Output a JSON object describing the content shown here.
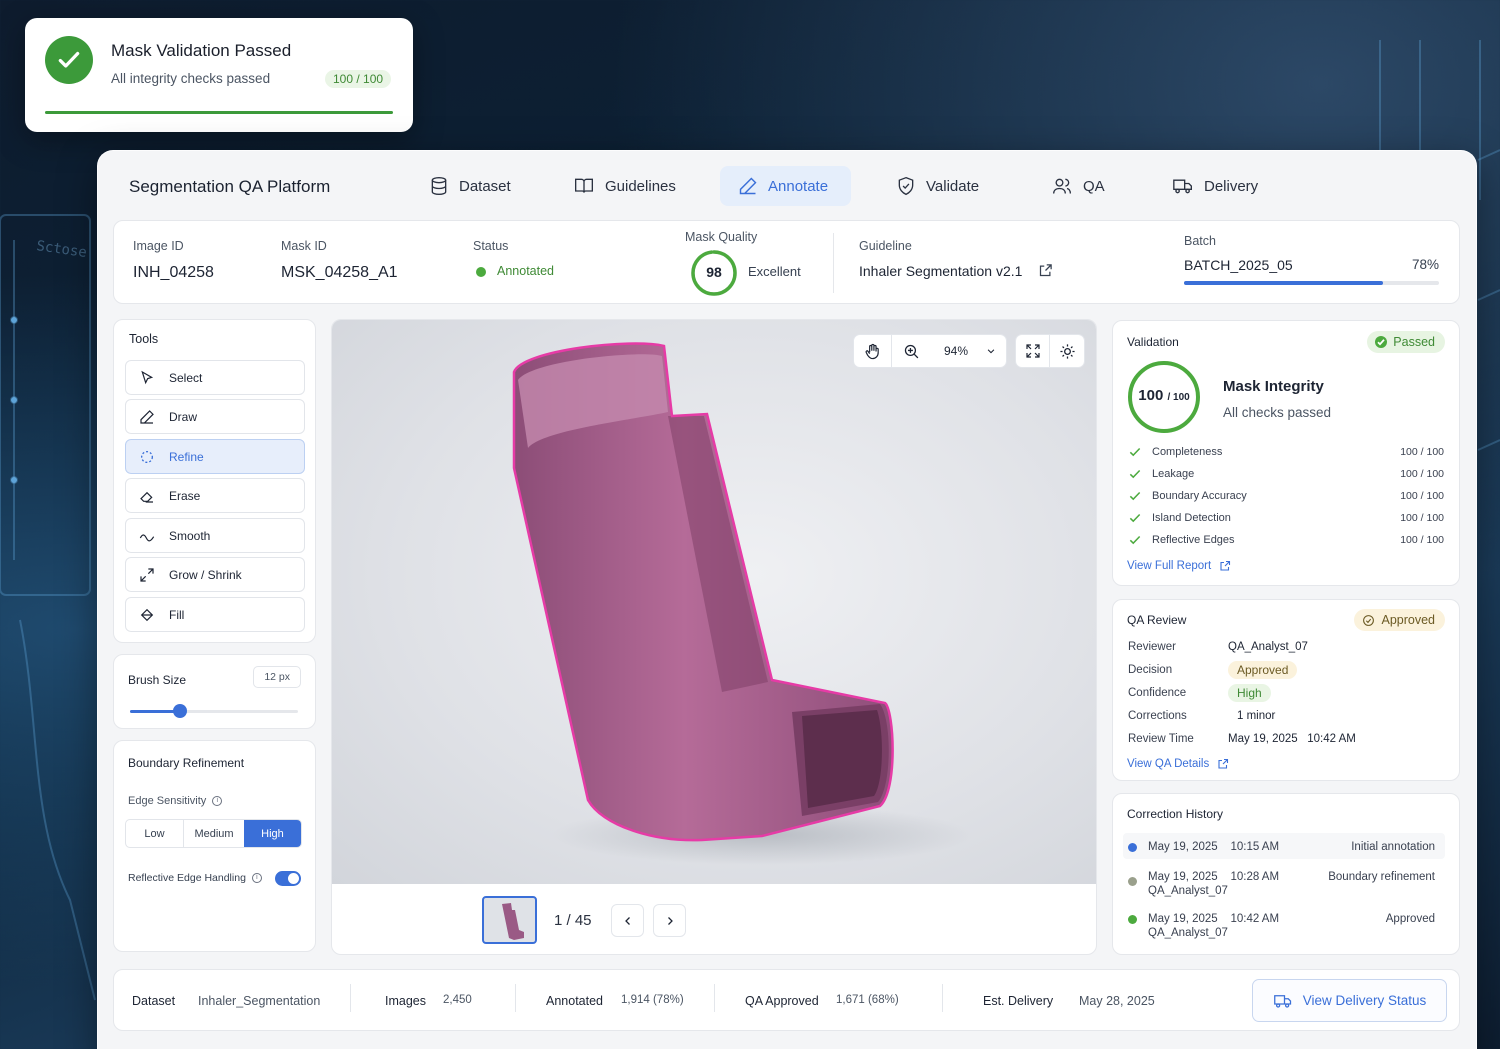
{
  "toast": {
    "title": "Mask Validation Passed",
    "subtitle": "All integrity checks passed",
    "score": "100 / 100"
  },
  "app": {
    "title": "Segmentation QA Platform"
  },
  "nav": [
    {
      "label": "Dataset",
      "icon": "database-icon"
    },
    {
      "label": "Guidelines",
      "icon": "book-icon"
    },
    {
      "label": "Annotate",
      "icon": "pen-icon",
      "active": true
    },
    {
      "label": "Validate",
      "icon": "shield-check-icon"
    },
    {
      "label": "QA",
      "icon": "users-icon"
    },
    {
      "label": "Delivery",
      "icon": "truck-icon"
    }
  ],
  "info": {
    "image_id_label": "Image ID",
    "image_id": "INH_04258",
    "mask_id_label": "Mask ID",
    "mask_id": "MSK_04258_A1",
    "status_label": "Status",
    "status": "Annotated",
    "quality_label": "Mask Quality",
    "quality_score": "98",
    "quality_value": 98,
    "quality_text": "Excellent",
    "guideline_label": "Guideline",
    "guideline": "Inhaler Segmentation v2.1",
    "batch_label": "Batch",
    "batch": "BATCH_2025_05",
    "batch_pct": "78%",
    "batch_progress": 0.78
  },
  "tools": {
    "title": "Tools",
    "items": [
      {
        "label": "Select",
        "icon": "cursor-icon"
      },
      {
        "label": "Draw",
        "icon": "pencil-icon"
      },
      {
        "label": "Refine",
        "icon": "lasso-icon",
        "active": true
      },
      {
        "label": "Erase",
        "icon": "eraser-icon"
      },
      {
        "label": "Smooth",
        "icon": "wave-icon"
      },
      {
        "label": "Grow / Shrink",
        "icon": "expand-arrows-icon"
      },
      {
        "label": "Fill",
        "icon": "bucket-icon"
      }
    ]
  },
  "brush": {
    "title": "Brush Size",
    "value": "12 px",
    "level": 0.3
  },
  "boundary": {
    "title": "Boundary Refinement",
    "edge_label": "Edge Sensitivity",
    "options": [
      "Low",
      "Medium",
      "High"
    ],
    "selected": "High",
    "reflective_label": "Reflective Edge Handling",
    "reflective_on": true
  },
  "viewer": {
    "zoom": "94%",
    "page": "1 / 45"
  },
  "validation": {
    "title": "Validation",
    "badge": "Passed",
    "score": "100",
    "score_total": "/ 100",
    "headline": "Mask Integrity",
    "sub": "All checks passed",
    "checks": [
      {
        "name": "Completeness",
        "score": "100 / 100"
      },
      {
        "name": "Leakage",
        "score": "100 / 100"
      },
      {
        "name": "Boundary Accuracy",
        "score": "100 / 100"
      },
      {
        "name": "Island Detection",
        "score": "100 / 100"
      },
      {
        "name": "Reflective Edges",
        "score": "100 / 100"
      }
    ],
    "link": "View Full Report"
  },
  "qa": {
    "title": "QA Review",
    "badge": "Approved",
    "rows": [
      {
        "label": "Reviewer",
        "value": "QA_Analyst_07"
      },
      {
        "label": "Decision",
        "value": "Approved"
      },
      {
        "label": "Confidence",
        "value": "High"
      },
      {
        "label": "Corrections",
        "value": "1 minor"
      },
      {
        "label": "Review Time",
        "value": "May 19, 2025   10:42 AM"
      }
    ],
    "link": "View QA Details"
  },
  "history": {
    "title": "Correction History",
    "items": [
      {
        "time": "May 19, 2025    10:15 AM",
        "user": "",
        "action": "Initial annotation",
        "color": "#3a6fd8"
      },
      {
        "time": "May 19, 2025    10:28 AM",
        "user": "QA_Analyst_07",
        "action": "Boundary refinement",
        "color": "#9aa08c"
      },
      {
        "time": "May 19, 2025    10:42 AM",
        "user": "QA_Analyst_07",
        "action": "Approved",
        "color": "#4caa3e"
      }
    ]
  },
  "footer": {
    "dataset_label": "Dataset",
    "dataset": "Inhaler_Segmentation",
    "images_label": "Images",
    "images": "2,450",
    "annotated_label": "Annotated",
    "annotated": "1,914 (78%)",
    "qa_label": "QA Approved",
    "qa": "1,671 (68%)",
    "delivery_label": "Est. Delivery",
    "delivery": "May 28, 2025",
    "button": "View Delivery Status"
  },
  "colors": {
    "accent": "#3a6fd8",
    "success": "#3c9a3a",
    "mask": "#e63ba6",
    "annotate_bg": "#e5eefb"
  }
}
